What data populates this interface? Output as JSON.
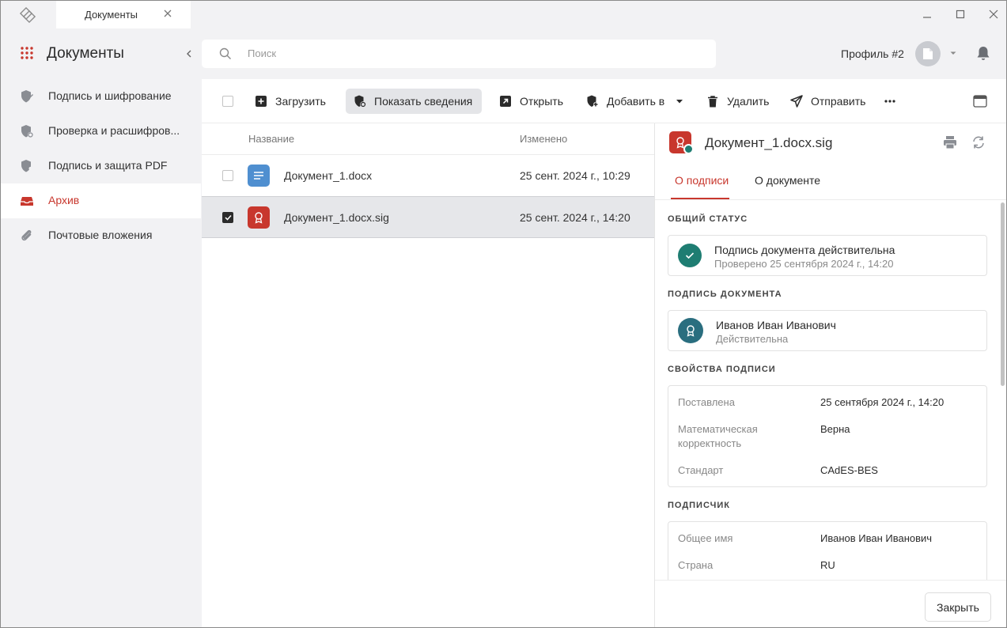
{
  "window": {
    "tab_title": "Документы"
  },
  "sidebar": {
    "title": "Документы",
    "items": [
      {
        "label": "Подпись и шифрование"
      },
      {
        "label": "Проверка и расшифров..."
      },
      {
        "label": "Подпись и защита PDF"
      },
      {
        "label": "Архив"
      },
      {
        "label": "Почтовые вложения"
      }
    ]
  },
  "topbar": {
    "search_placeholder": "Поиск",
    "profile_label": "Профиль #2"
  },
  "toolbar": {
    "upload": "Загрузить",
    "show_details": "Показать сведения",
    "open": "Открыть",
    "add_to": "Добавить в",
    "delete": "Удалить",
    "send": "Отправить"
  },
  "list": {
    "col_name": "Название",
    "col_modified": "Изменено",
    "rows": [
      {
        "name": "Документ_1.docx",
        "modified": "25 сент. 2024 г., 10:29",
        "selected": false
      },
      {
        "name": "Документ_1.docx.sig",
        "modified": "25 сент. 2024 г., 14:20",
        "selected": true
      }
    ]
  },
  "details": {
    "title": "Документ_1.docx.sig",
    "tab_signature": "О подписи",
    "tab_document": "О документе",
    "general_status_title": "ОБЩИЙ СТАТУС",
    "status_line1": "Подпись документа действительна",
    "status_line2": "Проверено 25 сентября 2024 г., 14:20",
    "doc_signature_title": "ПОДПИСЬ ДОКУМЕНТА",
    "signer_name": "Иванов Иван Иванович",
    "signer_status": "Действительна",
    "props_title": "СВОЙСТВА ПОДПИСИ",
    "props": [
      {
        "key": "Поставлена",
        "value": "25 сентября 2024 г., 14:20"
      },
      {
        "key": "Математическая корректность",
        "value": "Верна"
      },
      {
        "key": "Стандарт",
        "value": "CAdES-BES"
      }
    ],
    "subscriber_title": "ПОДПИСЧИК",
    "subscriber": [
      {
        "key": "Общее имя",
        "value": "Иванов Иван Иванович"
      },
      {
        "key": "Страна",
        "value": "RU"
      }
    ],
    "close_label": "Закрыть"
  },
  "colors": {
    "accent": "#c8372d",
    "valid": "#1e7d72",
    "signer": "#2a6e7f",
    "doc_icon": "#4f8fd0"
  }
}
